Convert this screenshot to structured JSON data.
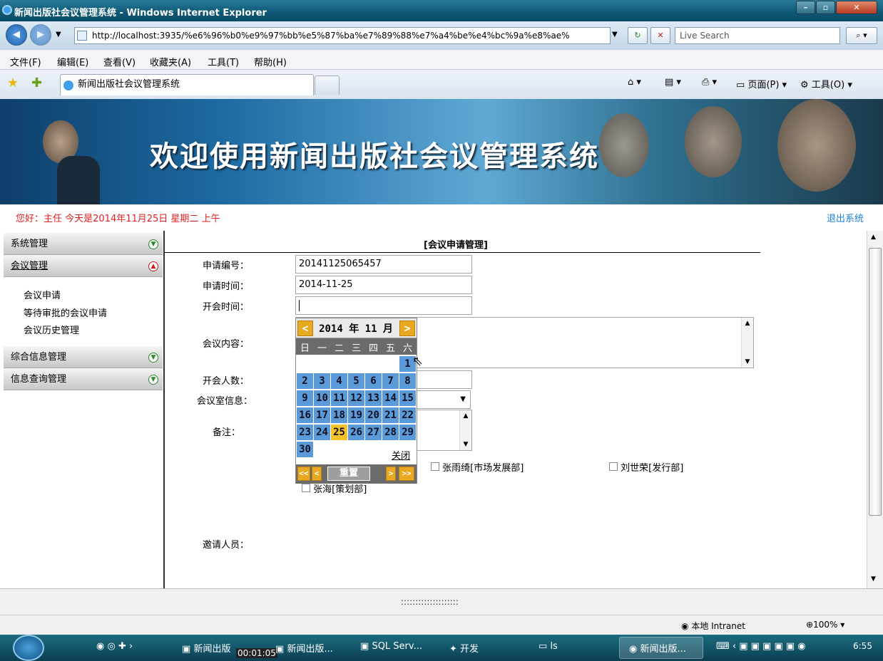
{
  "window": {
    "title": "新闻出版社会议管理系统 - Windows Internet Explorer"
  },
  "address": {
    "url": "http://localhost:3935/%e6%96%b0%e9%97%bb%e5%87%ba%e7%89%88%e7%a4%be%e4%bc%9a%e8%ae%",
    "search_placeholder": "Live Search"
  },
  "menu": [
    "文件(F)",
    "编辑(E)",
    "查看(V)",
    "收藏夹(A)",
    "工具(T)",
    "帮助(H)"
  ],
  "tab": {
    "title": "新闻出版社会议管理系统"
  },
  "commands": {
    "page": "页面(P)",
    "tools": "工具(O)"
  },
  "page": {
    "banner_title": "欢迎使用新闻出版社会议管理系统",
    "greeting": "您好：主任   今天是2014年11月25日  星期二  上午",
    "logout": "退出系统",
    "sidebar": {
      "sections": [
        "系统管理",
        "会议管理",
        "综合信息管理",
        "信息查询管理"
      ],
      "meeting_links": [
        "会议申请",
        "等待审批的会议申请",
        "会议历史管理"
      ]
    },
    "form": {
      "title": "[会议申请管理]",
      "labels": {
        "apply_no": "申请编号：",
        "apply_time": "申请时间：",
        "start_time": "开会时间：",
        "content": "会议内容：",
        "attendees": "开会人数：",
        "room": "会议室信息：",
        "remark": "备注：",
        "invitees": "邀请人员："
      },
      "values": {
        "apply_no": "20141125065457",
        "apply_time": "2014-11-25",
        "start_time": ""
      },
      "invitees": [
        "张雨绮[市场发展部]",
        "刘世荣[发行部]",
        "张海[策划部]"
      ]
    },
    "calendar": {
      "year_month": "2014 年 11 月",
      "weekdays": [
        "日",
        "一",
        "二",
        "三",
        "四",
        "五",
        "六"
      ],
      "days": [
        "1",
        "2",
        "3",
        "4",
        "5",
        "6",
        "7",
        "8",
        "9",
        "10",
        "11",
        "12",
        "13",
        "14",
        "15",
        "16",
        "17",
        "18",
        "19",
        "20",
        "21",
        "22",
        "23",
        "24",
        "25",
        "26",
        "27",
        "28",
        "29",
        "30"
      ],
      "today": "25",
      "close": "关闭",
      "reset": "重置",
      "prev": "<",
      "next": ">",
      "prev_year": "<<",
      "next_year": ">>"
    },
    "footer_dots": "::::::::::::::::::::"
  },
  "status": {
    "zone": "本地 Intranet",
    "zoom": "100%"
  },
  "taskbar": {
    "items": [
      "新闻出版",
      "新闻出版...",
      "SQL Serv...",
      "开发",
      "ls",
      "新闻出版..."
    ],
    "timer": "00:01:05",
    "clock": "6:55"
  }
}
